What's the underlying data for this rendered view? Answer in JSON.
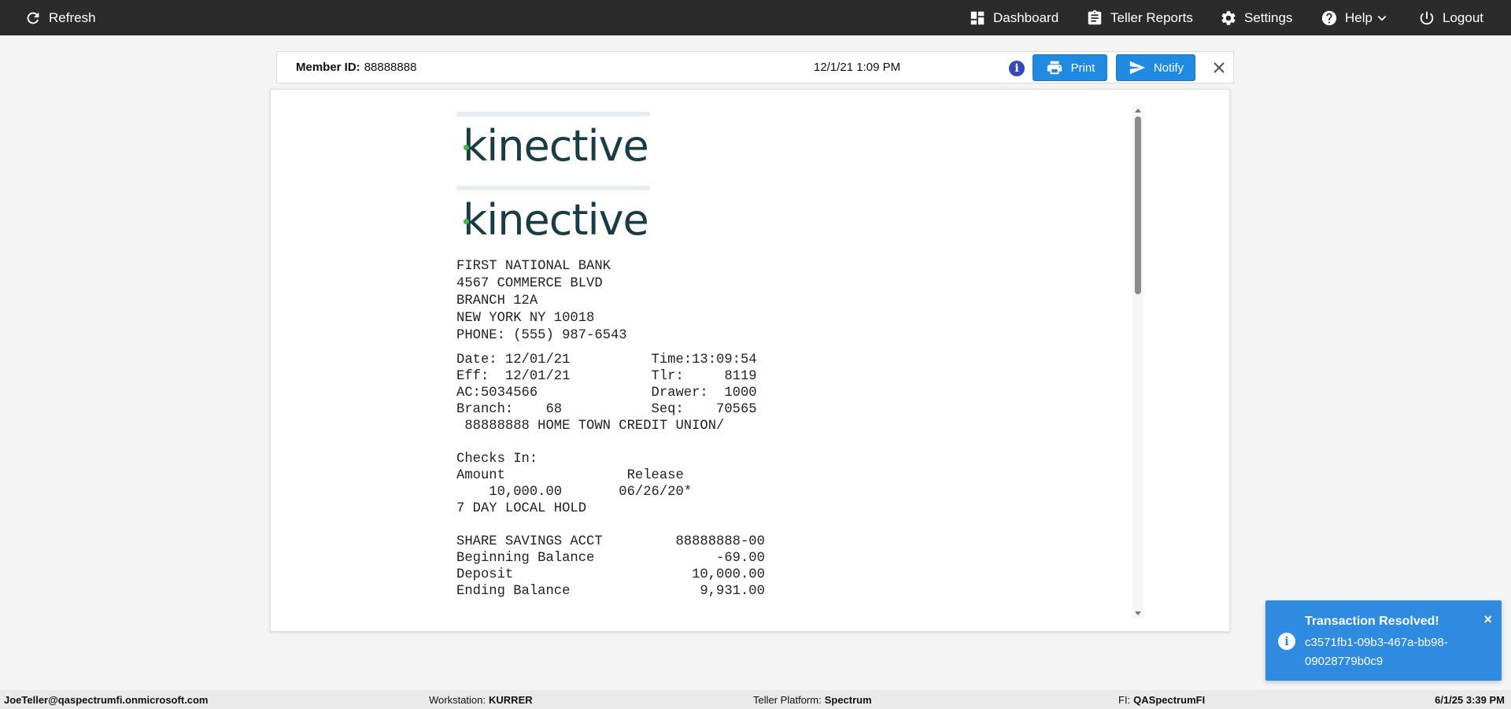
{
  "topbar": {
    "refresh_label": "Refresh",
    "dashboard_label": "Dashboard",
    "reports_label": "Teller Reports",
    "settings_label": "Settings",
    "help_label": "Help",
    "logout_label": "Logout"
  },
  "member_bar": {
    "member_id_label": "Member ID:",
    "member_id_value": "88888888",
    "datetime": "12/1/21 1:09 PM",
    "print_label": "Print",
    "notify_label": "Notify"
  },
  "receipt": {
    "logo_text": "kinective",
    "address": "FIRST NATIONAL BANK\n4567 COMMERCE BLVD\nBRANCH 12A\nNEW YORK NY 10018\nPHONE: (555) 987-6543",
    "body": "Date: 12/01/21          Time:13:09:54\nEff:  12/01/21          Tlr:     8119\nAC:5034566              Drawer:  1000\nBranch:    68           Seq:    70565\n 88888888 HOME TOWN CREDIT UNION/\n\nChecks In:\nAmount               Release\n    10,000.00       06/26/20*\n7 DAY LOCAL HOLD\n\nSHARE SAVINGS ACCT         88888888-00\nBeginning Balance               -69.00\nDeposit                      10,000.00\nEnding Balance                9,931.00"
  },
  "toast": {
    "title": "Transaction Resolved!",
    "message": "c3571fb1-09b3-467a-bb98-09028779b0c9",
    "close": "×"
  },
  "statusbar": {
    "user": "JoeTeller@qaspectrumfi.onmicrosoft.com",
    "workstation_label": "Workstation:",
    "workstation_value": "KURRER",
    "platform_label": "Teller Platform:",
    "platform_value": "Spectrum",
    "fi_label": "FI:",
    "fi_value": "QASpectrumFI",
    "datetime": "6/1/25 3:39 PM"
  },
  "colors": {
    "topbar": "#2b2b2b",
    "button": "#1f8ae0",
    "toast": "#2e8be0",
    "logo": "#1a3c45",
    "logo_accent": "#46b449"
  }
}
